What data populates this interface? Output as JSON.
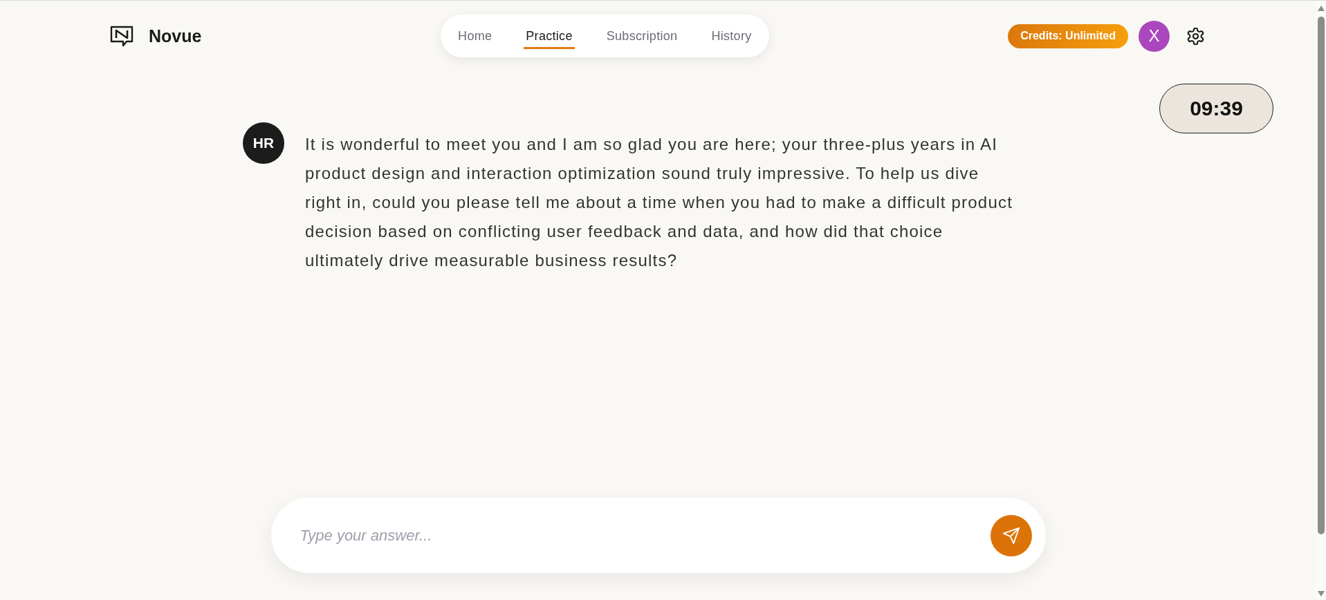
{
  "header": {
    "brand": "Novue",
    "nav": [
      {
        "label": "Home",
        "selected": false
      },
      {
        "label": "Practice",
        "selected": true
      },
      {
        "label": "Subscription",
        "selected": false
      },
      {
        "label": "History",
        "selected": false
      }
    ],
    "credits_badge": "Credits: Unlimited",
    "user_avatar": "X"
  },
  "timer": "09:39",
  "messages": [
    {
      "avatar": "HR",
      "text": "It is wonderful to meet you and I am so glad you are here; your three-plus years in AI product design and interaction optimization sound truly impressive. To help us dive right in, could you please tell me about a time when you had to make a difficult product decision based on conflicting user feedback and data, and how did that choice ultimately drive measurable business results?"
    }
  ],
  "answer_box": {
    "placeholder": "Type your answer..."
  }
}
